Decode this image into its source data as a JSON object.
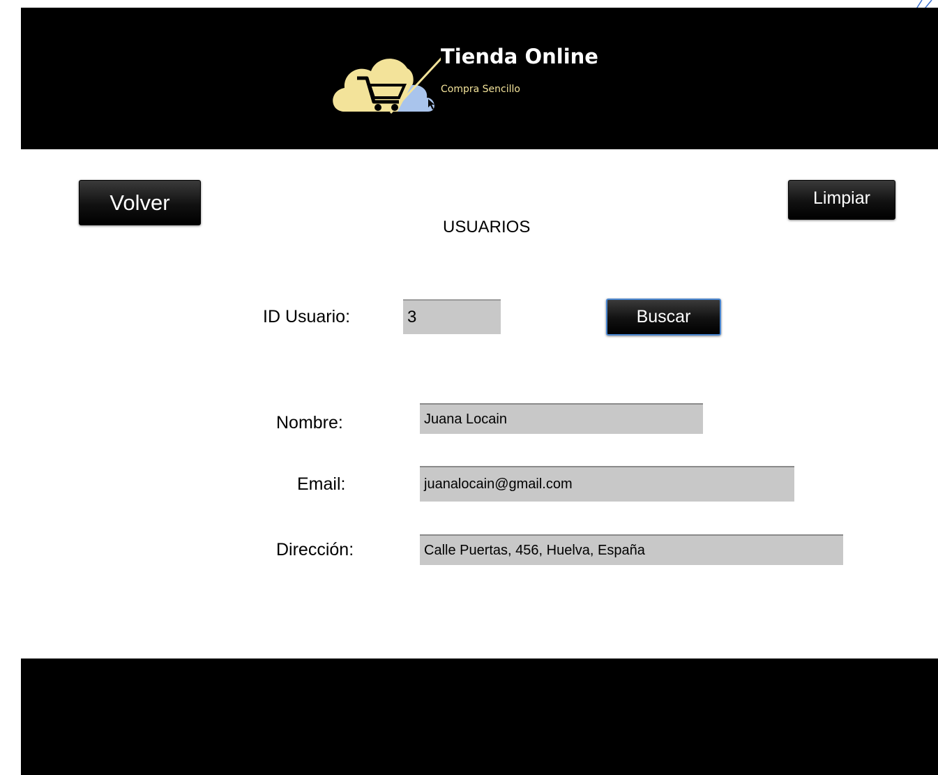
{
  "header": {
    "brand_title": "Tienda Online",
    "brand_tagline": "Compra Sencillo",
    "logo_icon": "cloud-cart-logo"
  },
  "toolbar": {
    "back_label": "Volver",
    "clear_label": "Limpiar"
  },
  "page": {
    "title": "USUARIOS"
  },
  "search": {
    "id_label": "ID Usuario:",
    "id_value": "3",
    "search_label": "Buscar"
  },
  "form": {
    "name_label": "Nombre:",
    "name_value": "Juana Locain",
    "email_label": "Email:",
    "email_value": "juanalocain@gmail.com",
    "address_label": "Dirección:",
    "address_value": "Calle Puertas, 456, Huelva, España"
  },
  "colors": {
    "header_bg": "#000000",
    "logo_yellow": "#f3e39a",
    "logo_blue": "#a9c4ec",
    "field_bg": "#c8c8c8",
    "focus_border": "#4a86d0"
  }
}
